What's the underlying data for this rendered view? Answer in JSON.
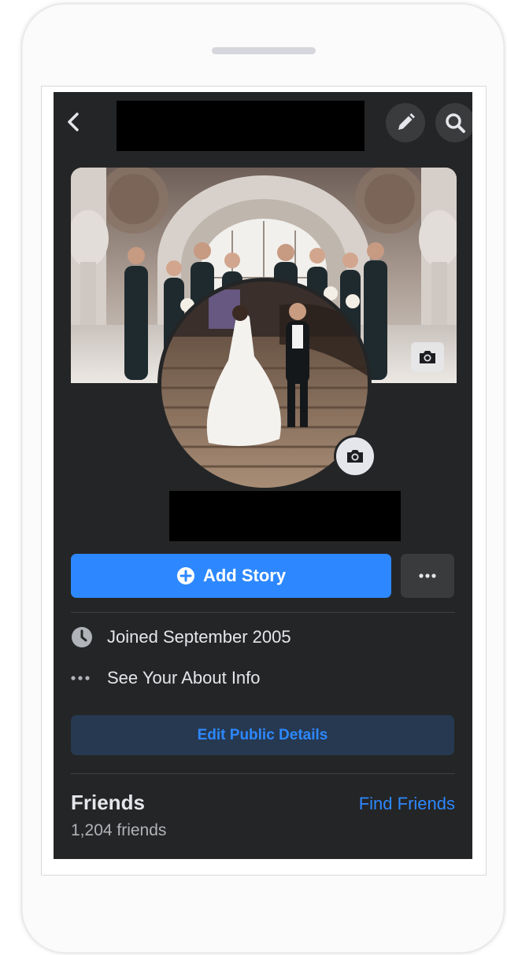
{
  "header": {
    "back_label": "Back",
    "edit_label": "Edit profile",
    "search_label": "Search"
  },
  "profile": {
    "cover_camera_label": "Change cover photo",
    "avatar_camera_label": "Change profile picture"
  },
  "actions": {
    "add_story_label": "Add Story",
    "more_label": "More"
  },
  "about": {
    "joined_text": "Joined September 2005",
    "see_about_text": "See Your About Info",
    "edit_details_label": "Edit Public Details"
  },
  "friends": {
    "title": "Friends",
    "find_label": "Find Friends",
    "count_text": "1,204 friends"
  },
  "colors": {
    "background": "#242526",
    "accent": "#2d88ff",
    "button_dark": "#3a3b3c",
    "edit_button_bg": "#263951",
    "secondary_text": "#b0b3b8"
  }
}
